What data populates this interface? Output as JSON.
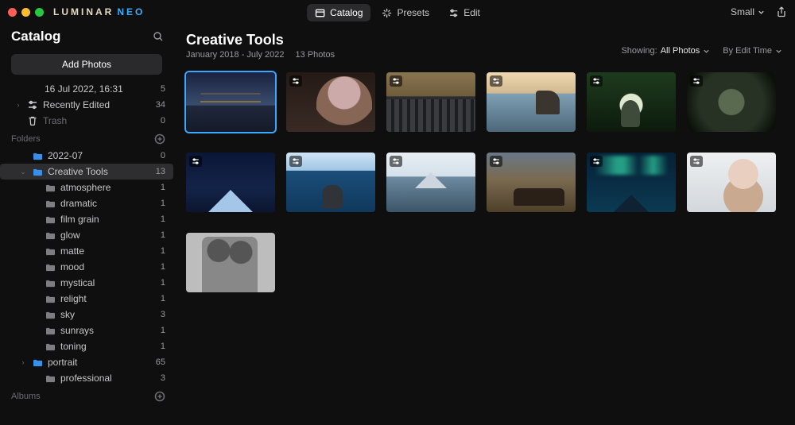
{
  "brand": {
    "word1": "LUMINAR",
    "word2": "NEO"
  },
  "topModes": {
    "catalog": "Catalog",
    "presets": "Presets",
    "edit": "Edit"
  },
  "sizeSelector": "Small",
  "sidebar": {
    "title": "Catalog",
    "addPhotos": "Add Photos",
    "shortcuts": [
      {
        "label": "16 Jul 2022, 16:31",
        "count": "5",
        "icon": null
      },
      {
        "label": "Recently Edited",
        "count": "34",
        "icon": "sliders"
      },
      {
        "label": "Trash",
        "count": "0",
        "icon": "trash",
        "muted": true
      }
    ],
    "foldersLabel": "Folders",
    "folders": [
      {
        "label": "2022-07",
        "count": "0",
        "depth": 1
      },
      {
        "label": "Creative Tools",
        "count": "13",
        "depth": 1,
        "expanded": true,
        "selected": true
      },
      {
        "label": "atmosphere",
        "count": "1",
        "depth": 2
      },
      {
        "label": "dramatic",
        "count": "1",
        "depth": 2
      },
      {
        "label": "film grain",
        "count": "1",
        "depth": 2
      },
      {
        "label": "glow",
        "count": "1",
        "depth": 2
      },
      {
        "label": "matte",
        "count": "1",
        "depth": 2
      },
      {
        "label": "mood",
        "count": "1",
        "depth": 2
      },
      {
        "label": "mystical",
        "count": "1",
        "depth": 2
      },
      {
        "label": "relight",
        "count": "1",
        "depth": 2
      },
      {
        "label": "sky",
        "count": "3",
        "depth": 2
      },
      {
        "label": "sunrays",
        "count": "1",
        "depth": 2
      },
      {
        "label": "toning",
        "count": "1",
        "depth": 2
      },
      {
        "label": "portrait",
        "count": "65",
        "depth": 1
      },
      {
        "label": "professional",
        "count": "3",
        "depth": 2
      }
    ],
    "albumsLabel": "Albums"
  },
  "main": {
    "title": "Creative Tools",
    "dateRange": "January 2018 - July 2022",
    "photoCount": "13 Photos",
    "filterShowingLabel": "Showing:",
    "filterShowingValue": "All Photos",
    "sortLabel": "By Edit Time",
    "thumbs": [
      {
        "art": "art-bridge",
        "selected": true,
        "edited": false
      },
      {
        "art": "art-portrait",
        "selected": false,
        "edited": true
      },
      {
        "art": "art-city",
        "selected": false,
        "edited": true
      },
      {
        "art": "art-coast",
        "selected": false,
        "edited": true
      },
      {
        "art": "art-jungle",
        "selected": false,
        "edited": true
      },
      {
        "art": "art-tunnel",
        "selected": false,
        "edited": true
      },
      {
        "art": "art-peak",
        "selected": false,
        "edited": true
      },
      {
        "art": "art-ocean",
        "selected": false,
        "edited": true
      },
      {
        "art": "art-fuji",
        "selected": false,
        "edited": true
      },
      {
        "art": "art-horses",
        "selected": false,
        "edited": true
      },
      {
        "art": "art-aurora",
        "selected": false,
        "edited": true
      },
      {
        "art": "art-woman",
        "selected": false,
        "edited": true
      },
      {
        "art": "art-bw",
        "selected": false,
        "edited": false
      }
    ]
  }
}
